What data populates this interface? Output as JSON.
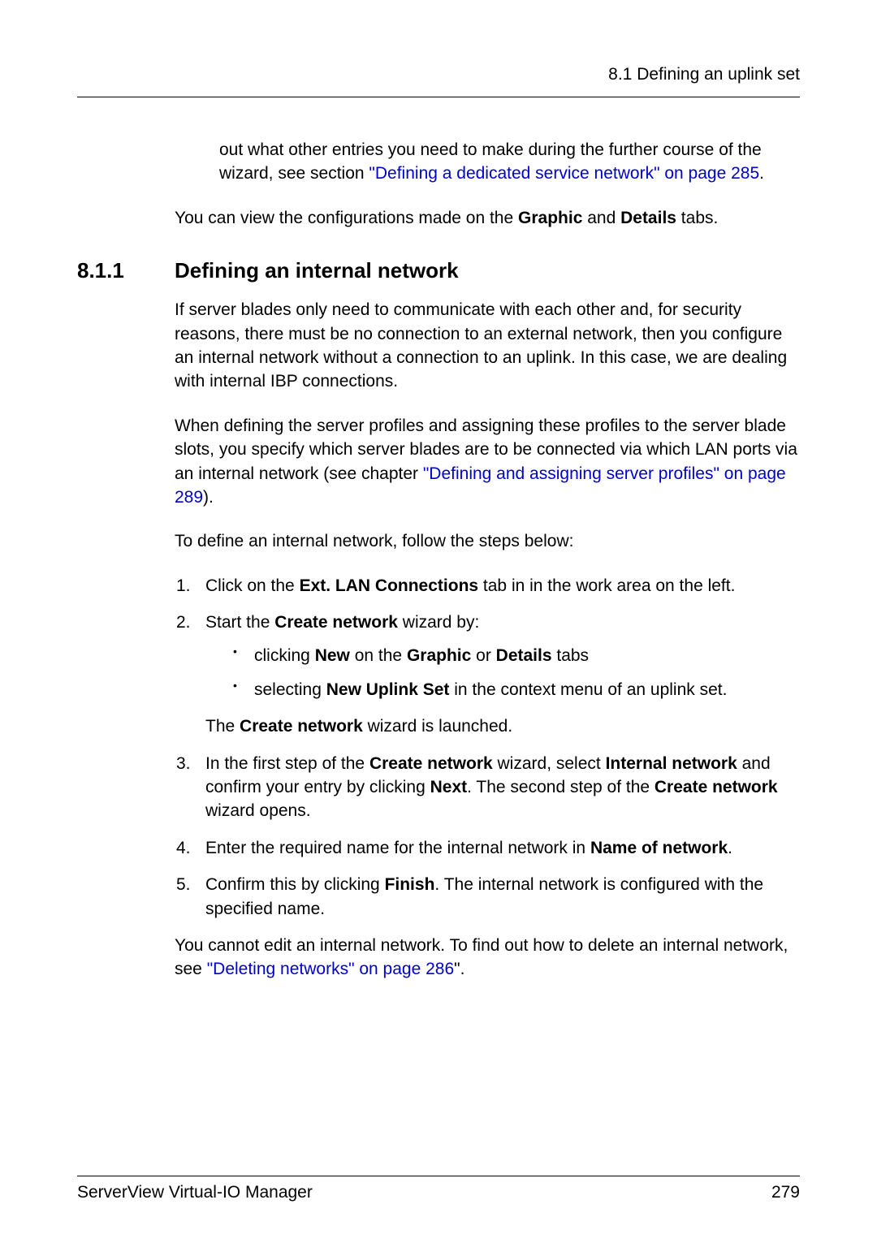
{
  "header": {
    "section_ref": "8.1 Defining an uplink set"
  },
  "top_para": {
    "text_before_link": "out what other entries you need to make during the further course of the wizard, see section ",
    "link_text": "\"Defining a dedicated service network\" on page 285",
    "text_after_link": "."
  },
  "intro_para": {
    "pre": "You can view the configurations made on the ",
    "bold1": "Graphic",
    "mid": " and ",
    "bold2": "Details",
    "post": " tabs."
  },
  "section": {
    "number": "8.1.1",
    "title": "Defining an internal network"
  },
  "para1": "If server blades only need to communicate with each other and, for security reasons, there must be no connection to an external network, then you configure an internal network without a connection to an uplink. In this case, we are dealing with internal IBP connections.",
  "para2": {
    "pre": "When defining the server profiles and assigning these profiles to the server blade slots, you specify which server blades are to be connected via which LAN ports via an internal network (see chapter ",
    "link": "\"Defining and assigning server profiles\" on page 289",
    "post": ")."
  },
  "para3": "To define an internal network, follow the steps below:",
  "steps": {
    "s1": {
      "num": "1.",
      "pre": "Click on the ",
      "bold": "Ext. LAN Connections",
      "post": " tab in in the work area on the left."
    },
    "s2": {
      "num": "2.",
      "pre": "Start the ",
      "bold": "Create network",
      "post": " wizard by:",
      "b1": {
        "pre": "clicking ",
        "bold1": "New",
        "mid1": " on the ",
        "bold2": "Graphic",
        "mid2": " or ",
        "bold3": "Details",
        "post": " tabs"
      },
      "b2": {
        "pre": "selecting ",
        "bold": "New Uplink Set",
        "post": " in the context menu of an uplink set."
      },
      "after": {
        "pre": "The ",
        "bold": "Create network",
        "post": " wizard is launched."
      }
    },
    "s3": {
      "num": "3.",
      "pre": "In the first step of the ",
      "bold1": "Create network",
      "mid1": " wizard, select ",
      "bold2": "Internal network",
      "mid2": " and confirm your entry by clicking ",
      "bold3": "Next",
      "mid3": ". The second step of the ",
      "bold4": "Create network",
      "post": " wizard opens."
    },
    "s4": {
      "num": "4.",
      "pre": "Enter the required name for the internal network in ",
      "bold": "Name of network",
      "post": "."
    },
    "s5": {
      "num": "5.",
      "pre": "Confirm this by clicking ",
      "bold": "Finish",
      "post": ". The internal network is configured with the specified name."
    }
  },
  "closing": {
    "pre": "You cannot edit an internal network. To find out how to delete an internal network, see ",
    "link": "\"Deleting networks\" on page 286",
    "post": "\"."
  },
  "footer": {
    "left": "ServerView Virtual-IO Manager",
    "right": "279"
  }
}
